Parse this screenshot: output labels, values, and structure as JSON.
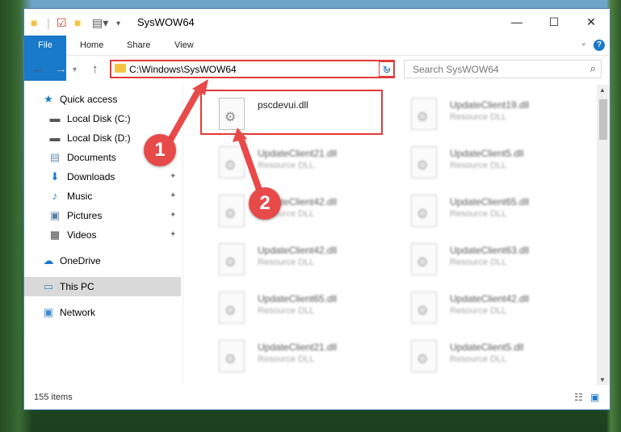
{
  "window": {
    "title": "SysWOW64",
    "minimize": "—",
    "maximize": "☐",
    "close": "✕"
  },
  "ribbon": {
    "tabs": [
      "File",
      "Home",
      "Share",
      "View"
    ]
  },
  "nav": {
    "address": "C:\\Windows\\SysWOW64",
    "search_placeholder": "Search SysWOW64"
  },
  "sidebar": {
    "items": [
      {
        "label": "Quick access",
        "icon": "star-icon"
      },
      {
        "label": "Local Disk (C:)",
        "icon": "drive-icon"
      },
      {
        "label": "Local Disk (D:)",
        "icon": "drive-icon"
      },
      {
        "label": "Documents",
        "icon": "documents-icon"
      },
      {
        "label": "Downloads",
        "icon": "download-icon"
      },
      {
        "label": "Music",
        "icon": "music-icon"
      },
      {
        "label": "Pictures",
        "icon": "pictures-icon"
      },
      {
        "label": "Videos",
        "icon": "videos-icon"
      },
      {
        "label": "OneDrive",
        "icon": "cloud-icon"
      },
      {
        "label": "This PC",
        "icon": "computer-icon"
      },
      {
        "label": "Network",
        "icon": "network-icon"
      }
    ]
  },
  "files": [
    {
      "name": "pscdevui.dll",
      "type": ""
    },
    {
      "name": "UpdateClient19.dll",
      "type": "Resource DLL"
    },
    {
      "name": "UpdateClient21.dll",
      "type": "Resource DLL"
    },
    {
      "name": "UpdateClient5.dll",
      "type": "Resource DLL"
    },
    {
      "name": "UpdateClient42.dll",
      "type": "Resource DLL"
    },
    {
      "name": "UpdateClient65.dll",
      "type": "Resource DLL"
    },
    {
      "name": "UpdateClient42.dll",
      "type": "Resource DLL"
    },
    {
      "name": "UpdateClient63.dll",
      "type": "Resource DLL"
    },
    {
      "name": "UpdateClient65.dll",
      "type": "Resource DLL"
    },
    {
      "name": "UpdateClient42.dll",
      "type": "Resource DLL"
    },
    {
      "name": "UpdateClient21.dll",
      "type": "Resource DLL"
    },
    {
      "name": "UpdateClient5.dll",
      "type": "Resource DLL"
    }
  ],
  "status": {
    "item_count": "155 items"
  },
  "annotations": {
    "badge1": "1",
    "badge2": "2",
    "color": "#e23a3a"
  }
}
